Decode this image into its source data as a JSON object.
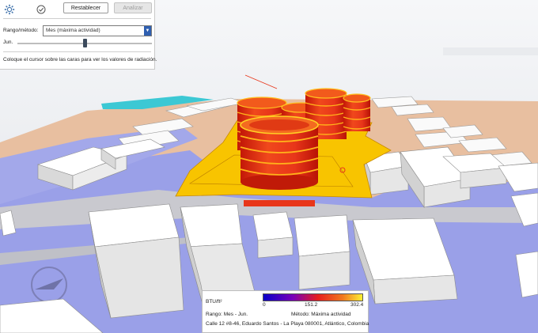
{
  "toolbar": {
    "settings_icon": "gear-icon",
    "check_icon": "check-circle-icon",
    "reset_label": "Restablecer",
    "analyze_label": "Analizar"
  },
  "controls": {
    "range_label": "Rango/método:",
    "range_value": "Mes (máxima actividad)",
    "month_label": "Jun.",
    "month_slider_value": 0.5,
    "hint": "Coloque el cursor sobre las caras para ver los valores de radiación."
  },
  "legend": {
    "unit": "BTU/ft²",
    "scale_min": "0",
    "scale_mid": "151.2",
    "scale_max": "302.4",
    "range_text": "Rango: Mes - Jun.",
    "method_text": "Método: Máxima actividad",
    "address": "Calle 12 #8-46, Eduardo Santos - La Playa 080001, Atlántico, Colombia",
    "colors": [
      "#0a00c8",
      "#c80fb4",
      "#e61e1e",
      "#f0781e",
      "#fff032"
    ]
  },
  "scene": {
    "sky_color": "#eef0f3",
    "ground_color": "#9aa0e8",
    "sand_color": "#e8bfa0",
    "site_color": "#f8c400",
    "tower_color": "#e83a18",
    "water_color": "#3cc8d4"
  }
}
